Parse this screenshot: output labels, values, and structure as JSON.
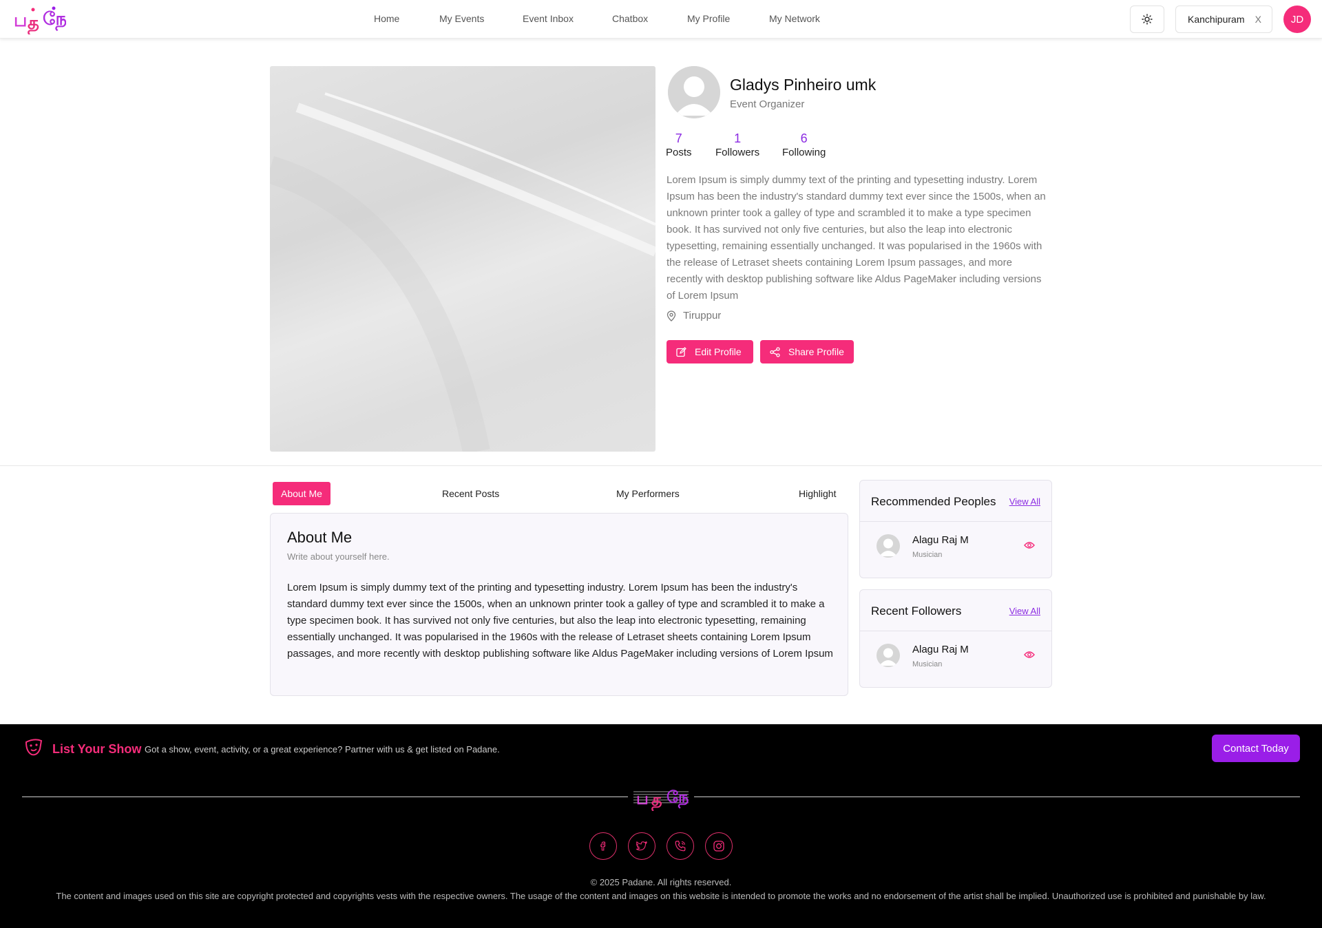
{
  "header": {
    "logo_text": "பதனே",
    "nav": [
      "Home",
      "My Events",
      "Event Inbox",
      "Chatbox",
      "My Profile",
      "My Network"
    ],
    "city": "Kanchipuram",
    "city_clear": "X",
    "user_initials": "JD"
  },
  "profile": {
    "name": "Gladys Pinheiro umk",
    "role": "Event Organizer",
    "stats": [
      {
        "value": "7",
        "label": "Posts"
      },
      {
        "value": "1",
        "label": "Followers"
      },
      {
        "value": "6",
        "label": "Following"
      }
    ],
    "bio": "Lorem Ipsum is simply dummy text of the printing and typesetting industry. Lorem Ipsum has been the industry's standard dummy text ever since the 1500s, when an unknown printer took a galley of type and scrambled it to make a type specimen book. It has survived not only five centuries, but also the leap into electronic typesetting, remaining essentially unchanged. It was popularised in the 1960s with the release of Letraset sheets containing Lorem Ipsum passages, and more recently with desktop publishing software like Aldus PageMaker including versions of Lorem Ipsum",
    "location": "Tiruppur",
    "edit_label": "Edit Profile",
    "share_label": "Share Profile"
  },
  "tabs": [
    "About Me",
    "Recent Posts",
    "My Performers",
    "Highlight"
  ],
  "about": {
    "title": "About Me",
    "subtitle": "Write about yourself here.",
    "text": "Lorem Ipsum is simply dummy text of the printing and typesetting industry. Lorem Ipsum has been the industry's standard dummy text ever since the 1500s, when an unknown printer took a galley of type and scrambled it to make a type specimen book. It has survived not only five centuries, but also the leap into electronic typesetting, remaining essentially unchanged. It was popularised in the 1960s with the release of Letraset sheets containing Lorem Ipsum passages, and more recently with desktop publishing software like Aldus PageMaker including versions of Lorem Ipsum"
  },
  "recommended": {
    "title": "Recommended Peoples",
    "view_all": "View All",
    "people": [
      {
        "name": "Alagu Raj M",
        "role": "Musician"
      }
    ]
  },
  "followers": {
    "title": "Recent Followers",
    "view_all": "View All",
    "people": [
      {
        "name": "Alagu Raj M",
        "role": "Musician"
      }
    ]
  },
  "footer": {
    "list_title": "List Your Show",
    "list_text": "Got a show, event, activity, or a great experience? Partner with us & get listed on Padane.",
    "contact_label": "Contact Today",
    "copyright": "© 2025 Padane. All rights reserved.",
    "disclaimer": "The content and images used on this site are copyright protected and copyrights vests with the respective owners. The usage of the content and images on this website is intended to promote the works and no endorsement of the artist shall be implied. Unauthorized use is prohibited and punishable by law.",
    "social_icons": [
      "facebook-icon",
      "twitter-icon",
      "phone-icon",
      "instagram-icon"
    ]
  },
  "colors": {
    "brand_pink": "#f52c7a",
    "brand_purple": "#8b2be2",
    "contact_purple": "#9a1ee8"
  }
}
